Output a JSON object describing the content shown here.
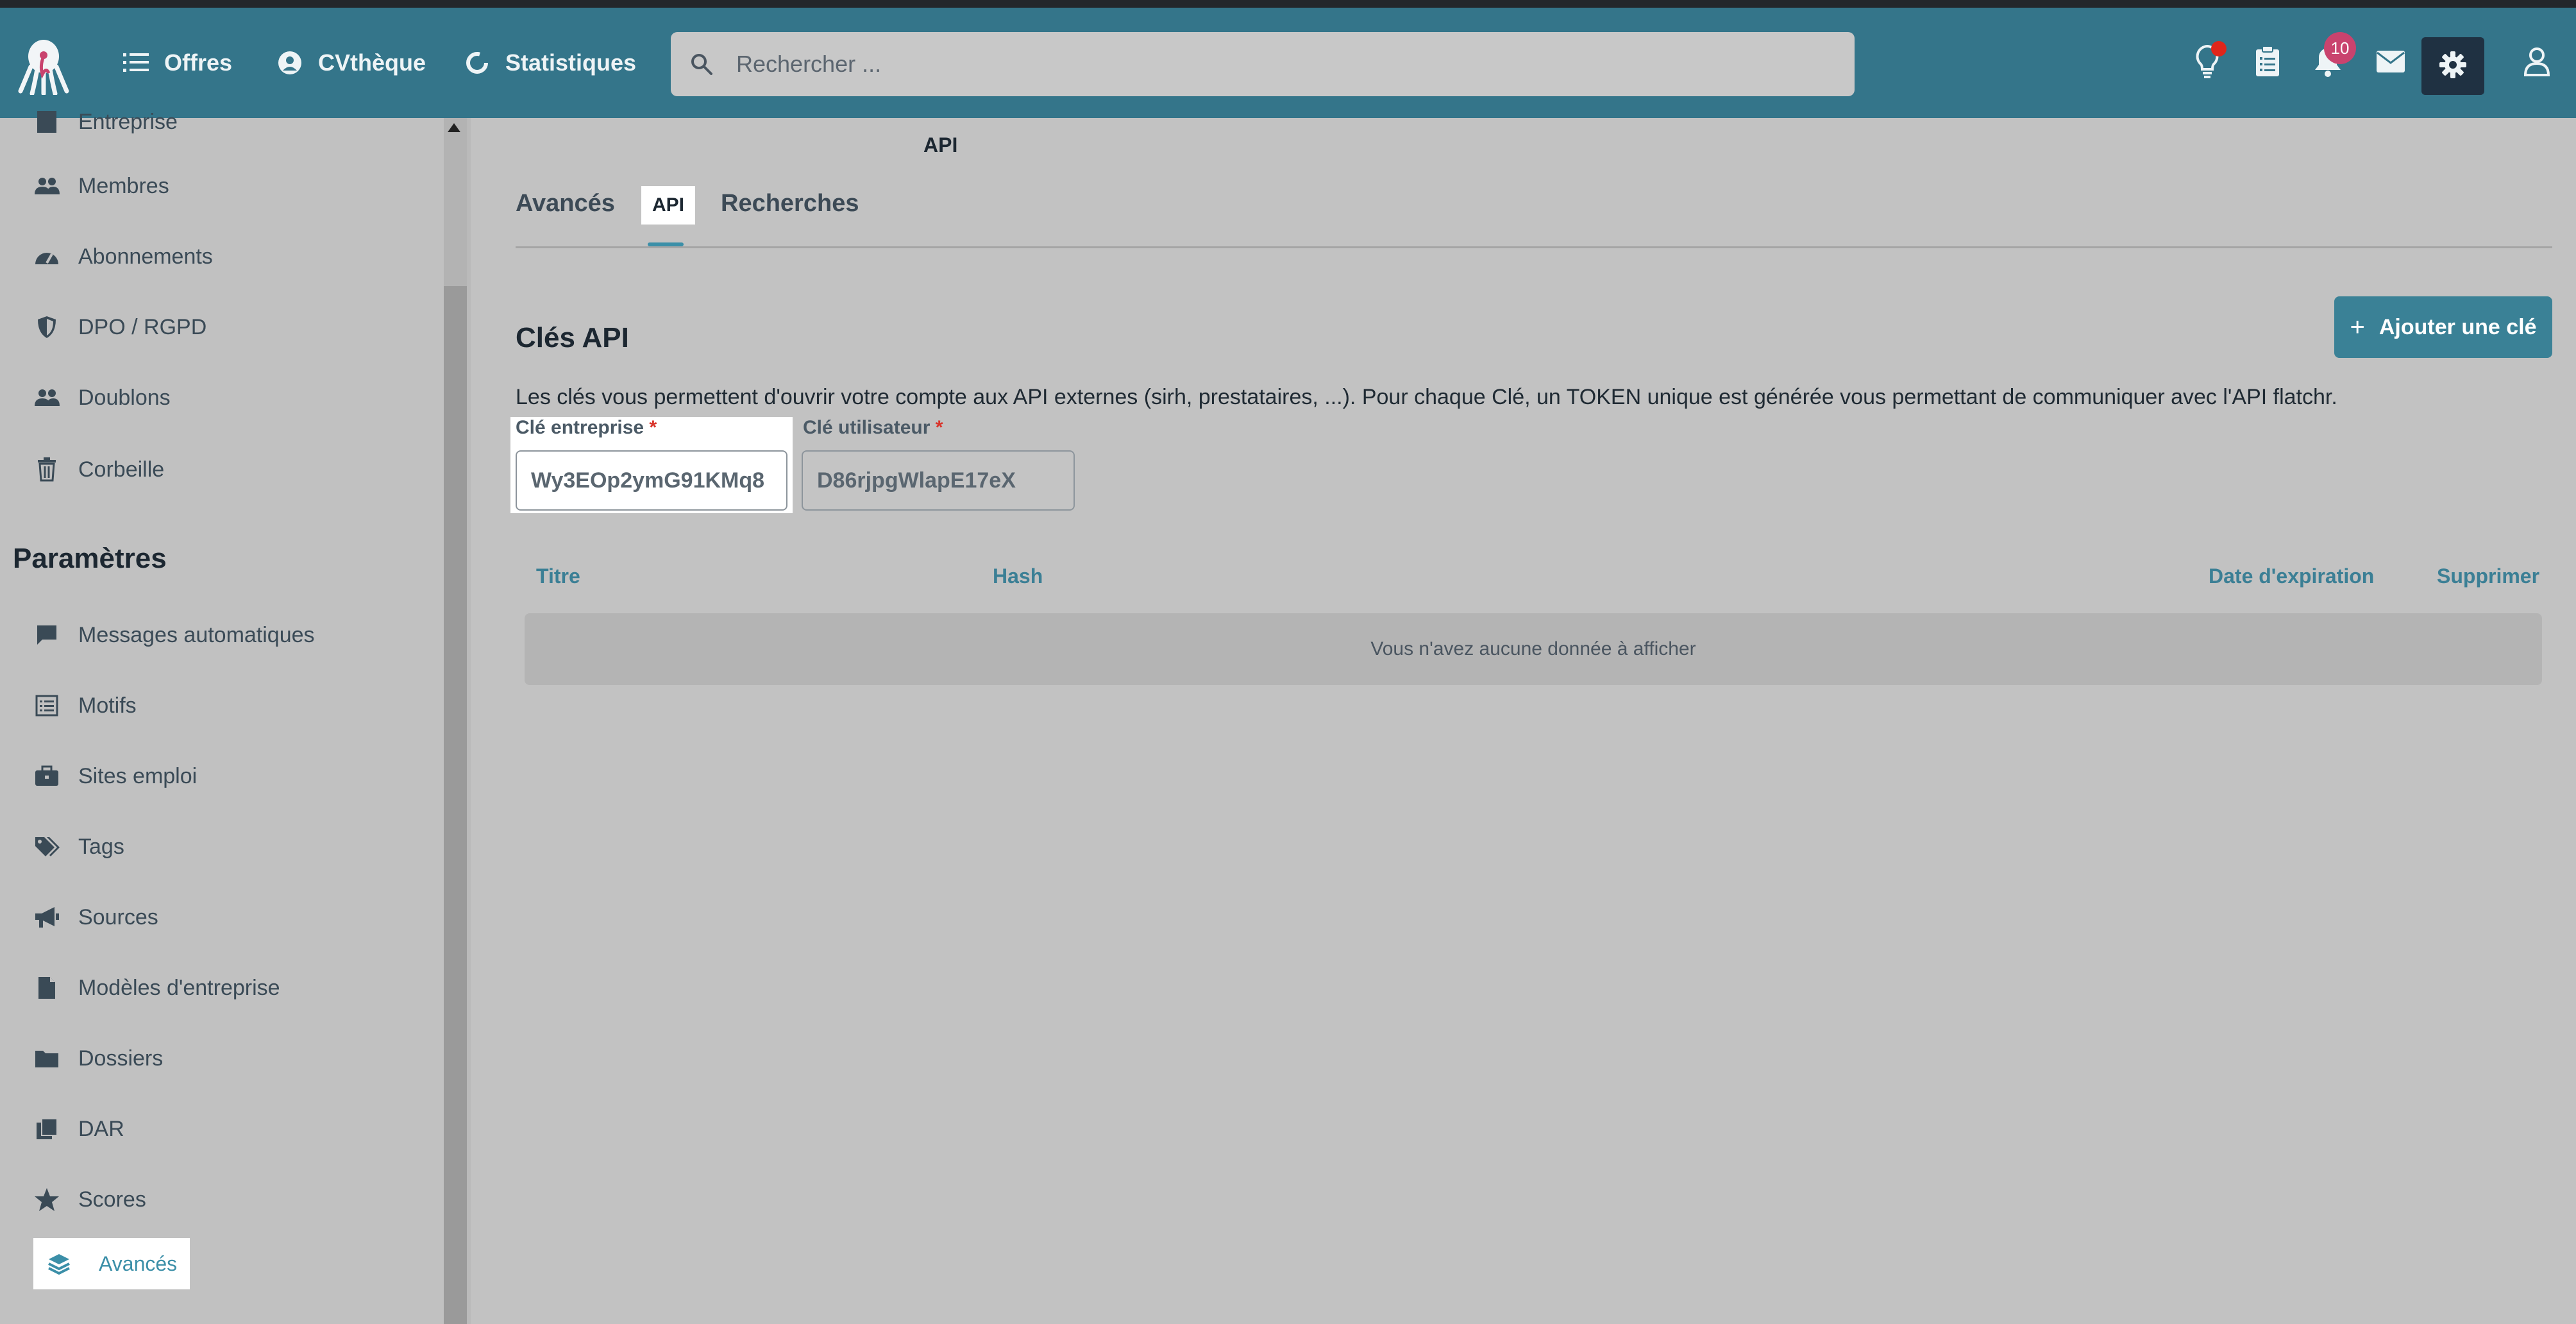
{
  "topbar": {
    "nav": [
      {
        "label": "Offres",
        "icon": "list-icon"
      },
      {
        "label": "CVthèque",
        "icon": "user-circle-icon"
      },
      {
        "label": "Statistiques",
        "icon": "chart-ring-icon"
      }
    ],
    "search_placeholder": "Rechercher ...",
    "notifications_count": "10",
    "colors": {
      "bar": "#34758a",
      "badge": "#c9436e",
      "dot": "#e0261b"
    }
  },
  "sidebar": {
    "top_partial_label": "Entreprise",
    "items": [
      {
        "label": "Membres",
        "icon": "users-icon"
      },
      {
        "label": "Abonnements",
        "icon": "gauge-icon"
      },
      {
        "label": "DPO / RGPD",
        "icon": "shield-icon"
      },
      {
        "label": "Doublons",
        "icon": "users-icon"
      }
    ],
    "corbeille": {
      "label": "Corbeille",
      "icon": "trash-icon"
    },
    "section_title": "Paramètres",
    "settings_items": [
      {
        "label": "Messages automatiques",
        "icon": "message-icon"
      },
      {
        "label": "Motifs",
        "icon": "list-box-icon"
      },
      {
        "label": "Sites emploi",
        "icon": "briefcase-icon"
      },
      {
        "label": "Tags",
        "icon": "tags-icon"
      },
      {
        "label": "Sources",
        "icon": "bullhorn-icon"
      },
      {
        "label": "Modèles d'entreprise",
        "icon": "file-icon"
      },
      {
        "label": "Dossiers",
        "icon": "folder-icon"
      },
      {
        "label": "DAR",
        "icon": "copy-icon"
      },
      {
        "label": "Scores",
        "icon": "star-icon"
      }
    ],
    "active_item": {
      "label": "Avancés",
      "icon": "layers-icon"
    }
  },
  "main": {
    "page_label": "API",
    "tabs": [
      {
        "label": "Avancés"
      },
      {
        "label": "API",
        "active": true
      },
      {
        "label": "Recherches"
      }
    ],
    "section_title": "Clés API",
    "add_button": "Ajouter une clé",
    "description": "Les clés vous permettent d'ouvrir votre compte aux API externes (sirh, prestataires, ...). Pour chaque Clé, un TOKEN unique est générée vous permettant de communiquer avec l'API flatchr.",
    "fields": {
      "entreprise": {
        "label": "Clé entreprise",
        "required_mark": "*",
        "value": "Wy3EOp2ymG91KMq8"
      },
      "utilisateur": {
        "label": "Clé utilisateur",
        "required_mark": "*",
        "value": "D86rjpgWlapE17eX"
      }
    },
    "table": {
      "headers": [
        "Titre",
        "Hash",
        "Date d'expiration",
        "Supprimer"
      ],
      "empty_message": "Vous n'avez aucune donnée à afficher"
    }
  }
}
